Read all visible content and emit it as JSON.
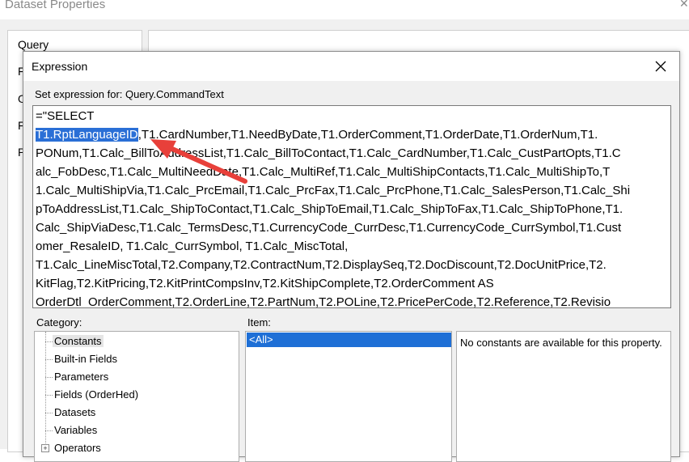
{
  "background_window": {
    "title": "Dataset Properties",
    "nav_items": [
      "Query",
      "F",
      "O",
      "F",
      "P"
    ]
  },
  "dialog": {
    "title": "Expression",
    "set_expression_label": "Set expression for: Query.CommandText",
    "expression": {
      "selected_text": "T1.RptLanguageID",
      "lines": [
        "=\"SELECT",
        ",T1.CardNumber,T1.NeedByDate,T1.OrderComment,T1.OrderDate,T1.OrderNum,T1.",
        "PONum,T1.Calc_BillToAddressList,T1.Calc_BillToContact,T1.Calc_CardNumber,T1.Calc_CustPartOpts,T1.C",
        "alc_FobDesc,T1.Calc_MultiNeedDate,T1.Calc_MultiRef,T1.Calc_MultiShipContacts,T1.Calc_MultiShipTo,T",
        "1.Calc_MultiShipVia,T1.Calc_PrcEmail,T1.Calc_PrcFax,T1.Calc_PrcPhone,T1.Calc_SalesPerson,T1.Calc_Shi",
        "pToAddressList,T1.Calc_ShipToContact,T1.Calc_ShipToEmail,T1.Calc_ShipToFax,T1.Calc_ShipToPhone,T1.",
        "Calc_ShipViaDesc,T1.Calc_TermsDesc,T1.CurrencyCode_CurrDesc,T1.CurrencyCode_CurrSymbol,T1.Cust",
        "omer_ResaleID, T1.Calc_CurrSymbol, T1.Calc_MiscTotal,",
        "T1.Calc_LineMiscTotal,T2.Company,T2.ContractNum,T2.DisplaySeq,T2.DocDiscount,T2.DocUnitPrice,T2.",
        "KitFlag,T2.KitPricing,T2.KitPrintCompsInv,T2.KitShipComplete,T2.OrderComment AS",
        "OrderDtl_OrderComment,T2.OrderLine,T2.PartNum,T2.POLine,T2.PricePerCode,T2.Reference,T2.Revisio"
      ]
    },
    "category_label": "Category:",
    "item_label": "Item:",
    "categories": [
      "Constants",
      "Built-in Fields",
      "Parameters",
      "Fields (OrderHed)",
      "Datasets",
      "Variables",
      "Operators"
    ],
    "items": [
      "<All>"
    ],
    "description": "No constants are available for this property.",
    "colors": {
      "selection": "#2a6fd6",
      "annotation_arrow": "#e8403a"
    }
  }
}
